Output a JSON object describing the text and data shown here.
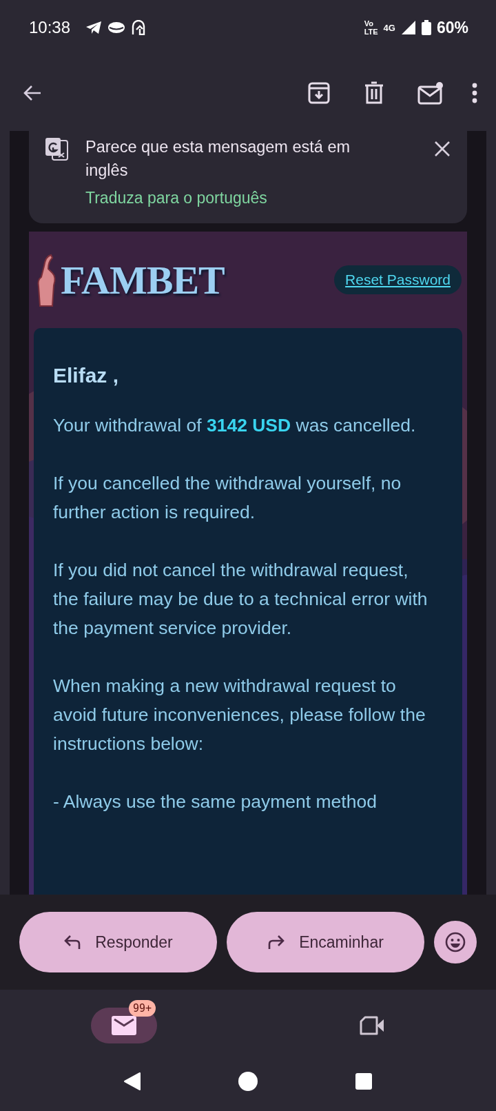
{
  "status_bar": {
    "time": "10:38",
    "vo": "Vo",
    "lte": "LTE",
    "network": "4G",
    "battery": "60%"
  },
  "translate_banner": {
    "message": "Parece que esta mensagem está em inglês",
    "link": "Traduza para o português"
  },
  "email": {
    "logo": "FAMBET",
    "reset_link": "Reset Password",
    "greeting": "Elifaz ,",
    "paragraphs": [
      "Your withdrawal of **3142 USD** was cancelled.",
      "If you cancelled the withdrawal yourself, no further action is required.",
      "If you did not cancel the withdrawal request, the failure may be due to a technical error with the payment service provider.",
      "When making a new withdrawal request to avoid future inconveniences, please follow the instructions below:",
      "- Always use the same payment method"
    ]
  },
  "actions": [
    {
      "kind": "reply",
      "label": "Responder"
    },
    {
      "kind": "forward",
      "label": "Encaminhar"
    }
  ],
  "bottom_nav": [
    {
      "kind": "mail",
      "selected": true,
      "badge": "99+"
    },
    {
      "kind": "video",
      "selected": false
    }
  ]
}
